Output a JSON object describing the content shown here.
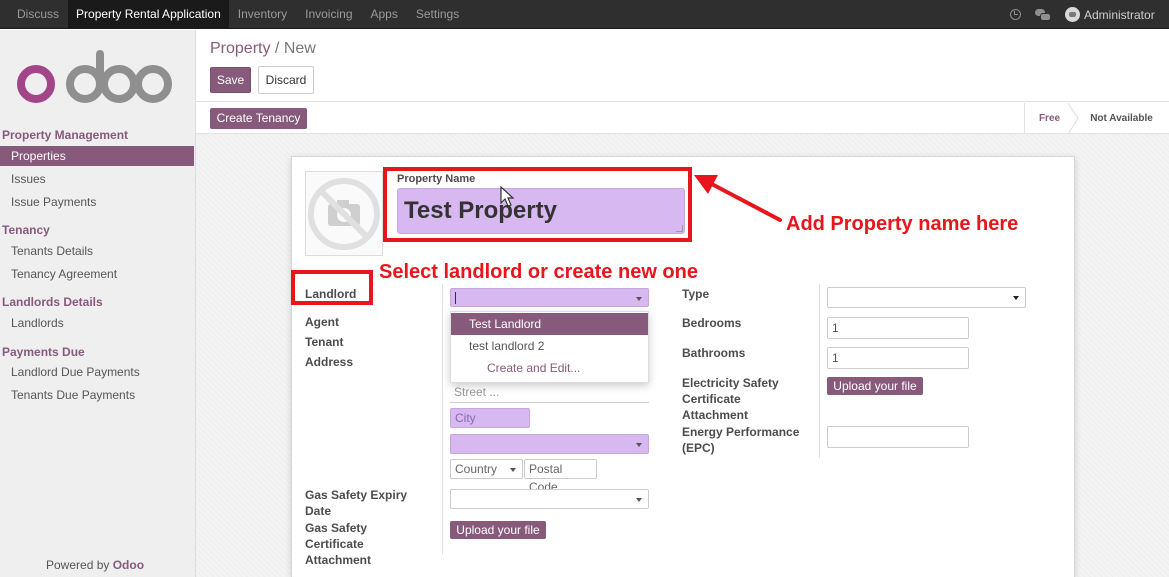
{
  "topbar": {
    "menu": [
      "Discuss",
      "Property Rental Application",
      "Inventory",
      "Invoicing",
      "Apps",
      "Settings"
    ],
    "active_index": 1,
    "user": "Administrator"
  },
  "sidebar": {
    "logo_text": "odoo",
    "sections": [
      {
        "title": "Property Management",
        "items": [
          "Properties",
          "Issues",
          "Issue Payments"
        ]
      },
      {
        "title": "Tenancy",
        "items": [
          "Tenants Details",
          "Tenancy Agreement"
        ]
      },
      {
        "title": "Landlords Details",
        "items": [
          "Landlords"
        ]
      },
      {
        "title": "Payments Due",
        "items": [
          "Landlord Due Payments",
          "Tenants Due Payments"
        ]
      }
    ],
    "active_item": "Properties",
    "powered_prefix": "Powered by ",
    "powered_brand": "Odoo"
  },
  "breadcrumb": {
    "parent": "Property",
    "separator": " / ",
    "current": "New"
  },
  "buttons": {
    "save": "Save",
    "discard": "Discard",
    "create_tenancy": "Create Tenancy"
  },
  "statusbar": {
    "stages": [
      "Free",
      "Not Available"
    ],
    "active": "Free"
  },
  "form": {
    "property_name_label": "Property Name",
    "property_name_value": "Test Property",
    "left_labels": {
      "landlord": "Landlord",
      "agent": "Agent",
      "tenant": "Tenant",
      "address": "Address",
      "gas_date": "Gas Safety Expiry Date",
      "gas_attach": "Gas Safety Certificate Attachment"
    },
    "address_placeholders": {
      "street": "Street ...",
      "city": "City",
      "country": "Country",
      "postal": "Postal Code"
    },
    "landlord_dropdown": [
      "Test Landlord",
      "test landlord 2",
      "Create and Edit..."
    ],
    "right_labels": {
      "type": "Type",
      "bedrooms": "Bedrooms",
      "bathrooms": "Bathrooms",
      "elec": "Electricity Safety Certificate Attachment",
      "epc": "Energy Performance (EPC)"
    },
    "bedrooms_value": "1",
    "bathrooms_value": "1",
    "upload_label": "Upload your file"
  },
  "annotations": {
    "property_name": "Add Property name here",
    "landlord": "Select landlord or create new one"
  },
  "colors": {
    "brand": "#875a7b",
    "field_bg": "#d8b8f0",
    "annotation": "#e8161c",
    "topbar": "#2f2f2f"
  }
}
